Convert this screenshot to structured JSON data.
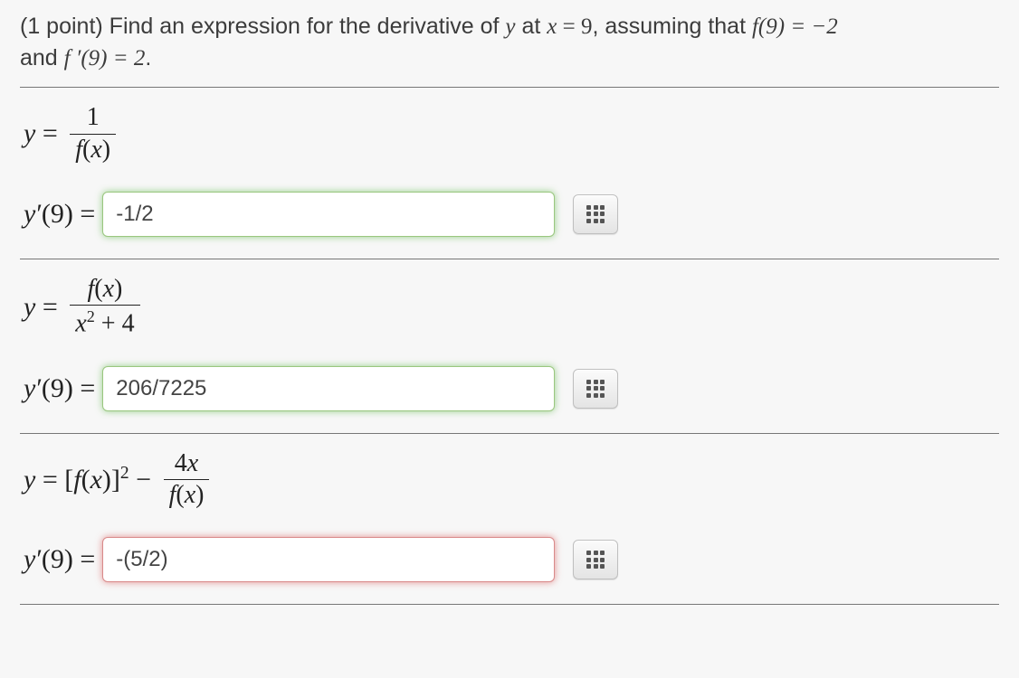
{
  "question": {
    "points_prefix": "(1 point) ",
    "text_before_y": "Find an expression for the derivative of ",
    "var_y": "y",
    "text_at": " at ",
    "var_x": "x",
    "eq1": " = 9",
    "text_assuming": ", assuming that ",
    "f9": "f(9) = −2",
    "text_and": " and ",
    "fprime9": "f ′(9) = 2",
    "period": "."
  },
  "parts": [
    {
      "expr_lhs": "y = ",
      "frac_num": "1",
      "frac_den": "f(x)",
      "answer_label": "y′(9) = ",
      "answer_value": "-1/2",
      "status": "correct"
    },
    {
      "expr_lhs": "y = ",
      "frac_num": "f(x)",
      "frac_den_html": "x² + 4",
      "answer_label": "y′(9) = ",
      "answer_value": "206/7225",
      "status": "correct"
    },
    {
      "expr_lhs_html": "y = [f(x)]² − ",
      "frac_num": "4x",
      "frac_den": "f(x)",
      "answer_label": "y′(9) = ",
      "answer_value": "-(5/2)",
      "status": "incorrect"
    }
  ]
}
